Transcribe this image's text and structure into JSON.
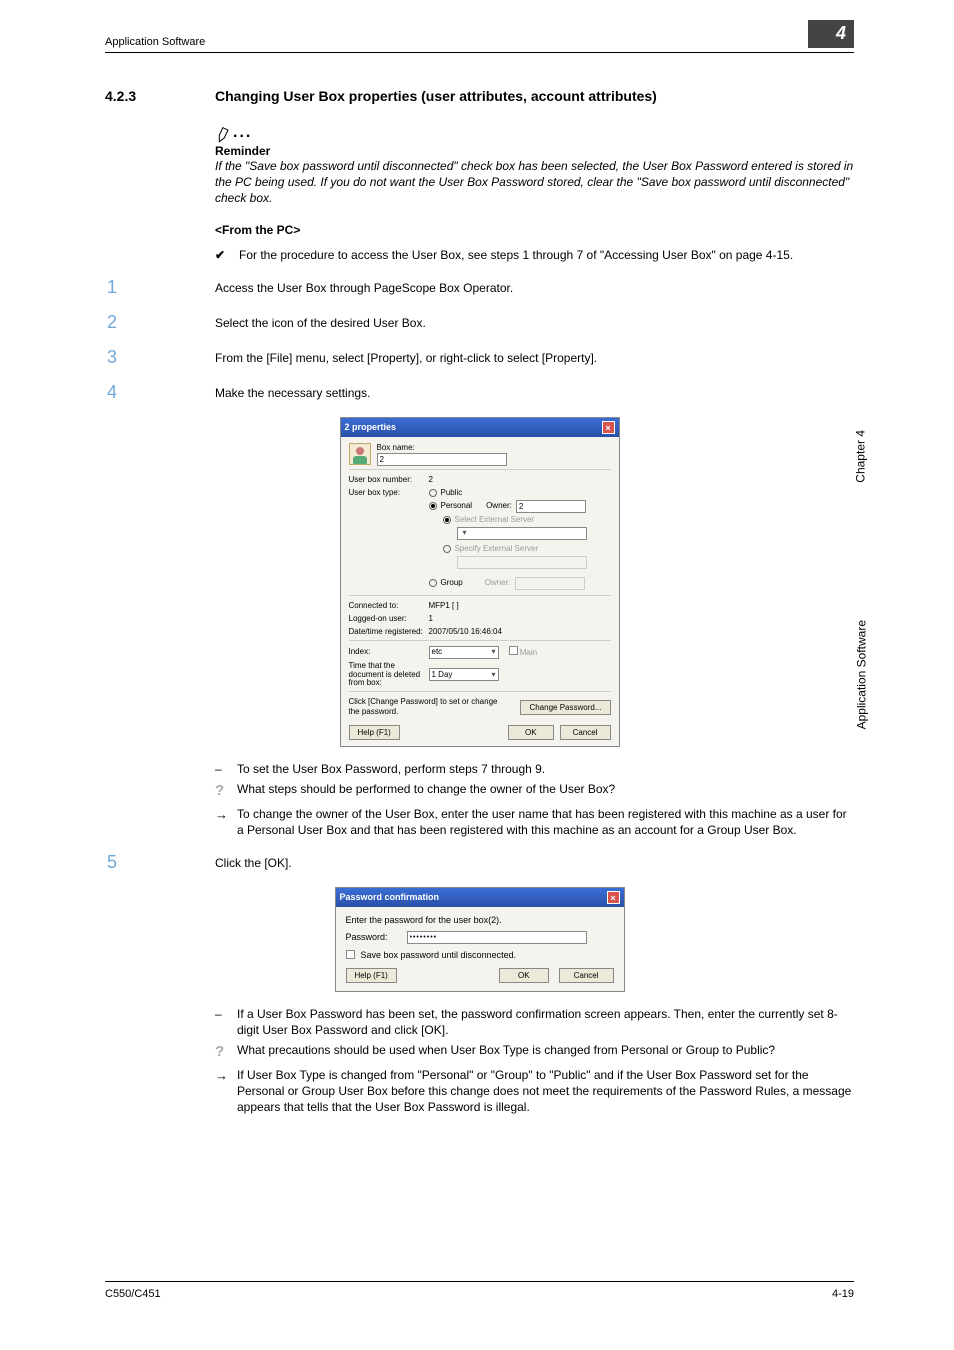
{
  "header": {
    "left": "Application Software"
  },
  "chapter_tab": "4",
  "side": {
    "chapter": "Chapter 4",
    "title": "Application Software"
  },
  "footer": {
    "left": "C550/C451",
    "right": "4-19"
  },
  "section": {
    "number": "4.2.3",
    "title": "Changing User Box properties (user attributes, account attributes)"
  },
  "reminder": {
    "label": "Reminder",
    "body": "If the \"Save box password until disconnected\" check box has been selected, the User Box Password entered is stored in the PC being used. If you do not want the User Box Password stored, clear the \"Save box password until disconnected\" check box."
  },
  "from_pc": "<From the PC>",
  "precheck": {
    "bullet": "✔",
    "text": "For the procedure to access the User Box, see steps 1 through 7 of \"Accessing User Box\" on page 4-15."
  },
  "steps": {
    "s1": "Access the User Box through PageScope Box Operator.",
    "s2": "Select the icon of the desired User Box.",
    "s3": "From the [File] menu, select [Property], or right-click to select [Property].",
    "s4": "Make the necessary settings.",
    "s5": "Click the [OK]."
  },
  "after4": {
    "dash1": "To set the User Box Password, perform steps 7 through 9.",
    "q": "What steps should be performed to change the owner of the User Box?",
    "a": "To change the owner of the User Box, enter the user name that has been registered with this machine as a user for a Personal User Box and that has been registered with this machine as an account for a Group User Box."
  },
  "after5": {
    "dash1": "If a User Box Password has been set, the password confirmation screen appears. Then, enter the currently set 8-digit User Box Password and click [OK].",
    "q": "What precautions should be used when User Box Type is changed from Personal or Group to Public?",
    "a": "If User Box Type is changed from \"Personal\" or \"Group\" to \"Public\" and if the User Box Password set for the Personal or Group User Box before this change does not meet the requirements of the Password Rules, a message appears that tells that the User Box Password is illegal."
  },
  "props_dialog": {
    "title": "2 properties",
    "box_name_label": "Box name:",
    "box_name_value": "2",
    "user_box_number_label": "User box number:",
    "user_box_number_value": "2",
    "user_box_type_label": "User box type:",
    "radio_public": "Public",
    "radio_personal": "Personal",
    "owner_label": "Owner:",
    "owner_value": "2",
    "select_external_label": "Select External Server",
    "specify_external_label": "Specify External Server",
    "radio_group": "Group",
    "group_owner_label": "Owner:",
    "connected_label": "Connected to:",
    "connected_value": "MFP1 [                  ]",
    "logged_label": "Logged-on user:",
    "logged_value": "1",
    "datetime_label": "Date/time registered:",
    "datetime_value": "2007/05/10 16:46:04",
    "index_label": "Index:",
    "index_value": "etc",
    "main_label": "Main",
    "delete_time_label": "Time that the document is deleted from box:",
    "delete_time_value": "1 Day",
    "change_pw_text": "Click [Change Password] to set or change the password.",
    "change_pw_btn": "Change Password...",
    "help_btn": "Help (F1)",
    "ok_btn": "OK",
    "cancel_btn": "Cancel"
  },
  "pwd_dialog": {
    "title": "Password confirmation",
    "prompt": "Enter the password for the user box(2).",
    "pw_label": "Password:",
    "pw_value": "••••••••",
    "save_chk_label": "Save box password until disconnected.",
    "help_btn": "Help (F1)",
    "ok_btn": "OK",
    "cancel_btn": "Cancel"
  }
}
